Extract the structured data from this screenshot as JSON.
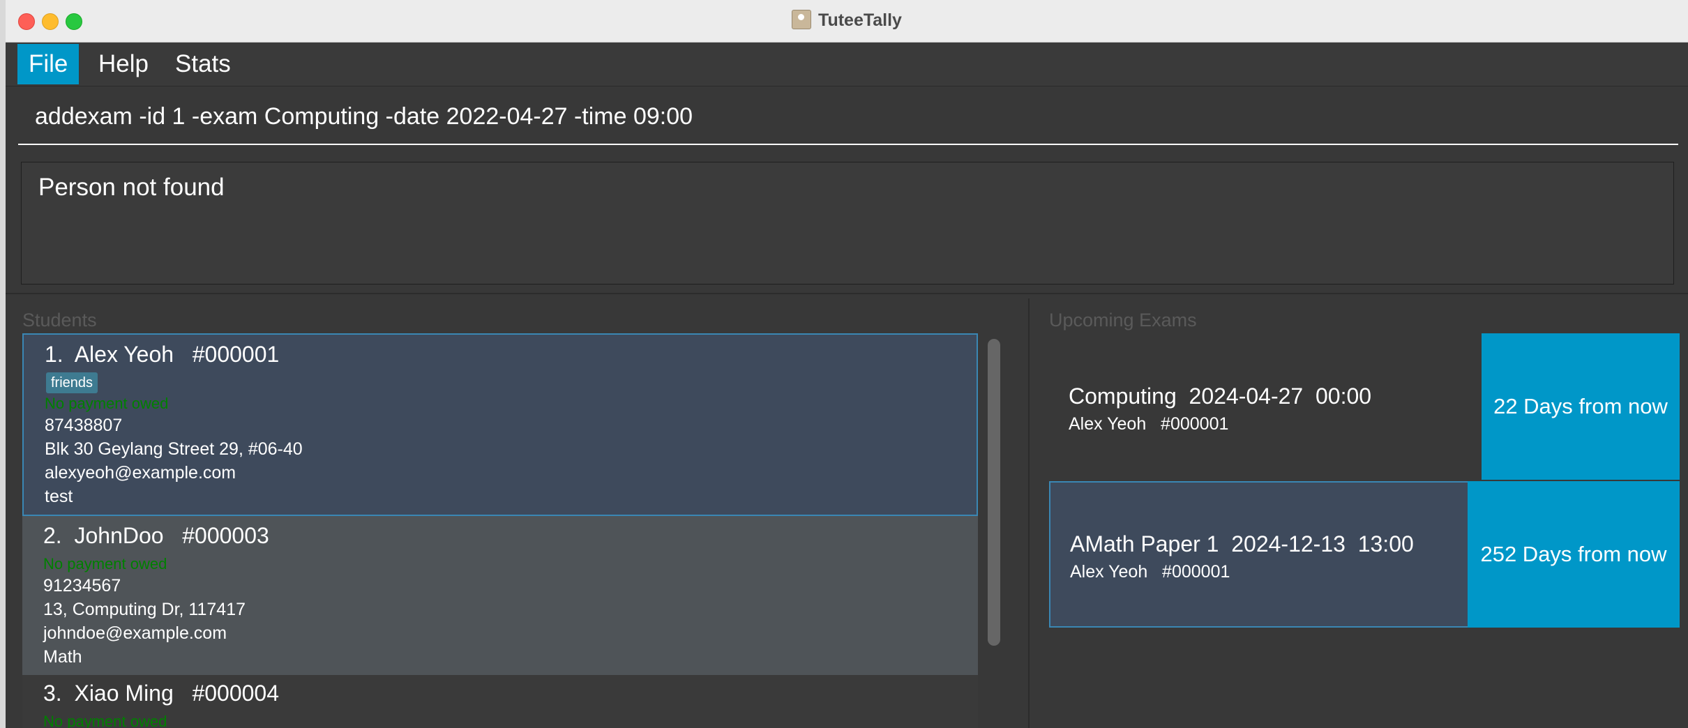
{
  "window": {
    "title": "TuteeTally"
  },
  "menu": {
    "file": "File",
    "help": "Help",
    "stats": "Stats"
  },
  "command": {
    "value": "addexam -id 1 -exam Computing -date 2022-04-27 -time 09:00"
  },
  "result": {
    "text": "Person not found"
  },
  "students": {
    "label": "Students",
    "items": [
      {
        "title": "1.  Alex Yeoh   #000001",
        "tag": "friends",
        "payment": "No payment owed",
        "phone": "87438807",
        "address": "Blk 30 Geylang Street 29, #06-40",
        "email": "alexyeoh@example.com",
        "subject": "test"
      },
      {
        "title": "2.  JohnDoo   #000003",
        "payment": "No payment owed",
        "phone": "91234567",
        "address": "13, Computing Dr, 117417",
        "email": "johndoe@example.com",
        "subject": "Math"
      },
      {
        "title": "3.  Xiao Ming   #000004",
        "payment": "No payment owed"
      }
    ]
  },
  "exams": {
    "label": "Upcoming Exams",
    "items": [
      {
        "title": "Computing  2024-04-27  00:00",
        "student": "Alex Yeoh   #000001",
        "days": "22 Days from now"
      },
      {
        "title": "AMath Paper 1  2024-12-13  13:00",
        "student": "Alex Yeoh   #000001",
        "days": "252 Days from now"
      }
    ]
  },
  "colors": {
    "accent": "#0097c8",
    "payment_ok": "#008000",
    "selected_border": "#3a87b4"
  }
}
